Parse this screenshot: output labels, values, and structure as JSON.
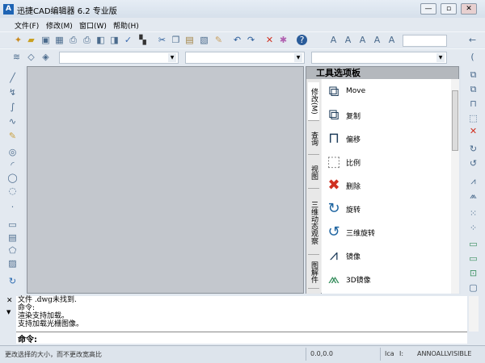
{
  "window": {
    "title": "迅捷CAD编辑器 6.2 专业版",
    "icon": "A",
    "minimize": "—",
    "maximize": "▫",
    "close": "✕"
  },
  "menu": [
    "文件(F)",
    "修改(M)",
    "窗口(W)",
    "帮助(H)"
  ],
  "palette": {
    "title": "工具选项板",
    "tabs": [
      "修改(M)",
      "查询",
      "视图",
      "三维动态观察",
      "图解件"
    ],
    "items": [
      {
        "label": "Move",
        "icon": "move-icon",
        "glyph": "⧉"
      },
      {
        "label": "复制",
        "icon": "copy-icon",
        "glyph": "⧉"
      },
      {
        "label": "偏移",
        "icon": "offset-icon",
        "glyph": "⊓"
      },
      {
        "label": "比例",
        "icon": "scale-icon",
        "glyph": "⬚"
      },
      {
        "label": "删除",
        "icon": "delete-icon",
        "glyph": "✖"
      },
      {
        "label": "旋转",
        "icon": "rotate-icon",
        "glyph": "↻"
      },
      {
        "label": "三维旋转",
        "icon": "rotate-3d-icon",
        "glyph": "↺"
      },
      {
        "label": "镜像",
        "icon": "mirror-icon",
        "glyph": "⩘"
      },
      {
        "label": "3D镜像",
        "icon": "mirror-3d-icon",
        "glyph": "⩕"
      }
    ]
  },
  "command": {
    "log": [
      "文件            .dwg未找到.",
      "命令:",
      "渲染支持加载。",
      "支持加载光栅图像。"
    ],
    "prompt": "命令:"
  },
  "status": {
    "message": "更改选择的大小，而不更改宽高比",
    "coords": "0.0,0.0",
    "f1": "Ica",
    "f2": "I:",
    "annotation": "ANNOALLVISIBLE"
  }
}
